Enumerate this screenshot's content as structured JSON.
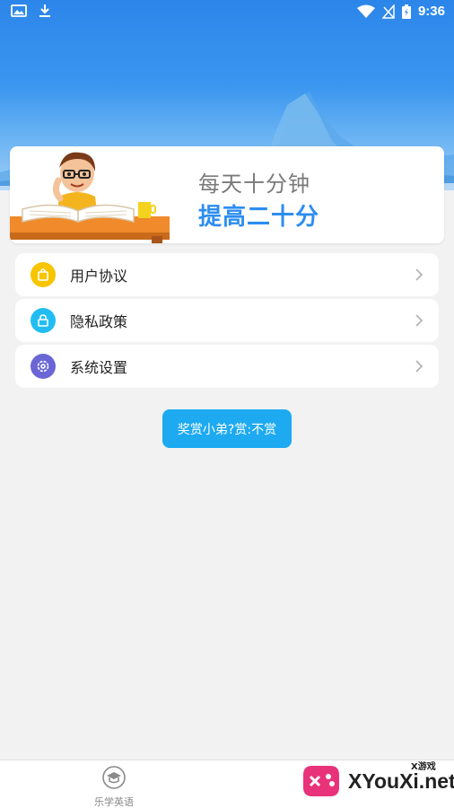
{
  "status_bar": {
    "time": "9:36"
  },
  "banner": {
    "line1": "每天十分钟",
    "line2": "提高二十分"
  },
  "menu": [
    {
      "label": "用户协议",
      "icon": "shopping-bag-icon",
      "color": "#f6c500"
    },
    {
      "label": "隐私政策",
      "icon": "lock-icon",
      "color": "#21bdf2"
    },
    {
      "label": "系统设置",
      "icon": "gear-icon",
      "color": "#6a66d6"
    }
  ],
  "reward_button": {
    "label": "奖赏小弟?赏:不赏"
  },
  "bottom_nav": {
    "items": [
      {
        "label": "乐学英语",
        "icon": "graduation-cap-icon"
      }
    ]
  },
  "watermark": {
    "text": "XYouXi.net",
    "small": "X游戏"
  },
  "colors": {
    "accent": "#2d8df0",
    "button": "#1eaaf1",
    "background": "#f2f2f2"
  }
}
